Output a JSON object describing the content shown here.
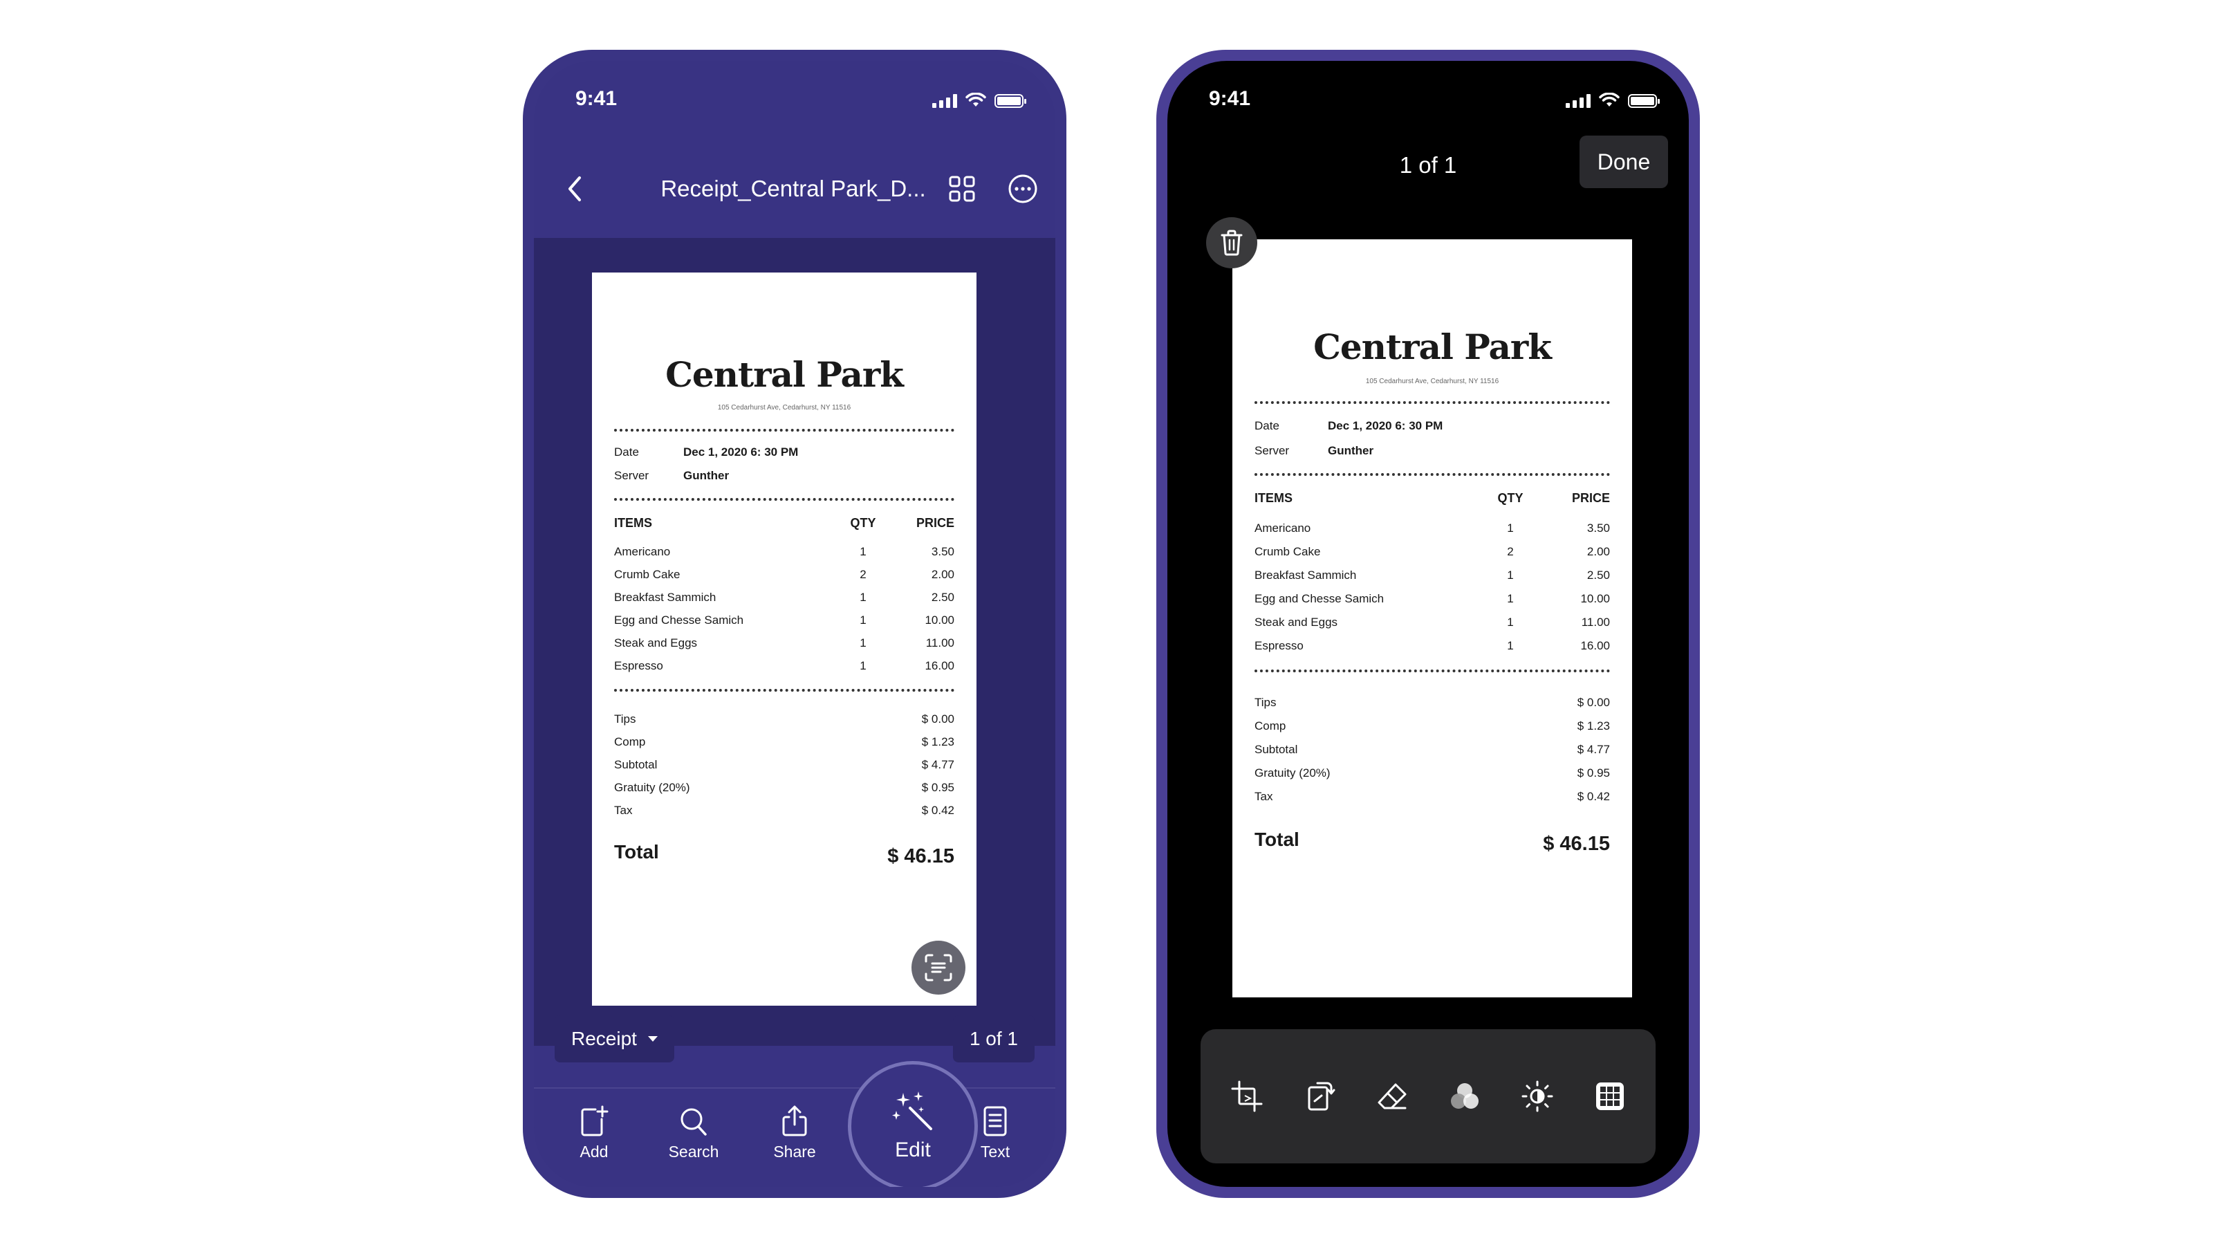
{
  "left_phone": {
    "status": {
      "time": "9:41"
    },
    "nav": {
      "title": "Receipt_Central Park_D...",
      "back_icon": "chevron-left-icon",
      "grid_icon": "grid-icon",
      "more_icon": "more-icon"
    },
    "receipt": {
      "name": "Central Park",
      "address": "105 Cedarhurst Ave, Cedarhurst, NY 11516",
      "date_label": "Date",
      "date_value": "Dec 1, 2020 6: 30 PM",
      "server_label": "Server",
      "server_value": "Gunther",
      "headers": {
        "items": "ITEMS",
        "qty": "QTY",
        "price": "PRICE"
      },
      "items": [
        {
          "name": "Americano",
          "qty": "1",
          "price": "3.50"
        },
        {
          "name": "Crumb Cake",
          "qty": "2",
          "price": "2.00"
        },
        {
          "name": "Breakfast Sammich",
          "qty": "1",
          "price": "2.50"
        },
        {
          "name": "Egg and Chesse  Samich",
          "qty": "1",
          "price": "10.00"
        },
        {
          "name": "Steak and Eggs",
          "qty": "1",
          "price": "11.00"
        },
        {
          "name": "Espresso",
          "qty": "1",
          "price": "16.00"
        }
      ],
      "summary": [
        {
          "label": "Tips",
          "amount": "$ 0.00"
        },
        {
          "label": "Comp",
          "amount": "$ 1.23"
        },
        {
          "label": "Subtotal",
          "amount": "$ 4.77"
        },
        {
          "label": "Gratuity (20%)",
          "amount": "$ 0.95"
        },
        {
          "label": "Tax",
          "amount": "$ 0.42"
        }
      ],
      "total_label": "Total",
      "total_amount": "$ 46.15"
    },
    "doc_type": "Receipt",
    "page_indicator": "1 of 1",
    "toolbar": {
      "add": "Add",
      "search": "Search",
      "share": "Share",
      "edit": "Edit",
      "text": "Text"
    }
  },
  "right_phone": {
    "status": {
      "time": "9:41"
    },
    "page_counter": "1 of 1",
    "done_label": "Done",
    "edit_tools": [
      "crop-icon",
      "rotate-icon",
      "eraser-icon",
      "filter-icon",
      "brightness-icon",
      "grid-icon"
    ]
  },
  "colors": {
    "left_bg": "#393383",
    "doc_bg": "#2c2768",
    "right_bg": "#000000",
    "frame_right": "#4a3f95"
  }
}
